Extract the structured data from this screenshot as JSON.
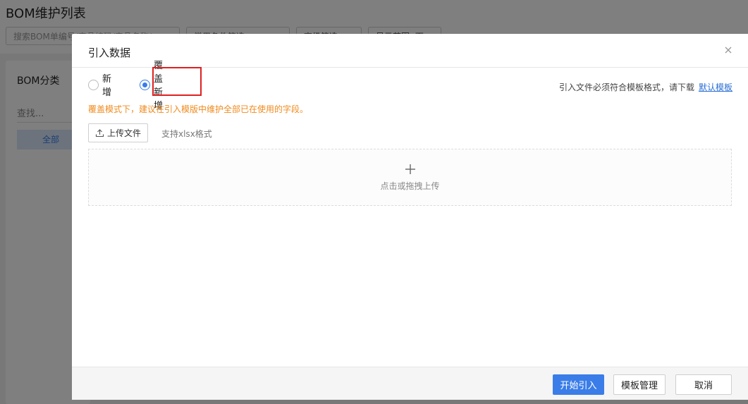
{
  "background": {
    "title": "BOM维护列表",
    "search_placeholder": "搜索BOM单编号/产品编码/产品名称/...",
    "filter_select": "常用条件筛选",
    "advanced_filter": "高级筛选",
    "display_range": "显示范围: 下",
    "sidebar": {
      "title": "BOM分类",
      "search_placeholder": "查找...",
      "all_label": "全部"
    }
  },
  "modal": {
    "title": "引入数据",
    "radio_options": [
      {
        "label": "新增",
        "checked": false
      },
      {
        "label": "覆盖新增",
        "checked": true
      }
    ],
    "template_hint": "引入文件必须符合模板格式，请下载",
    "template_link": "默认模板",
    "warning": "覆盖模式下，建议在引入模版中维护全部已在使用的字段。",
    "upload_label": "上传文件",
    "format_hint": "支持xlsx格式",
    "dropzone_text": "点击或拖拽上传",
    "footer": {
      "start_label": "开始引入",
      "template_manage_label": "模板管理",
      "cancel_label": "取消"
    }
  },
  "colors": {
    "primary": "#3a7de8",
    "warning": "#f08a1c",
    "highlight": "#e02020"
  }
}
